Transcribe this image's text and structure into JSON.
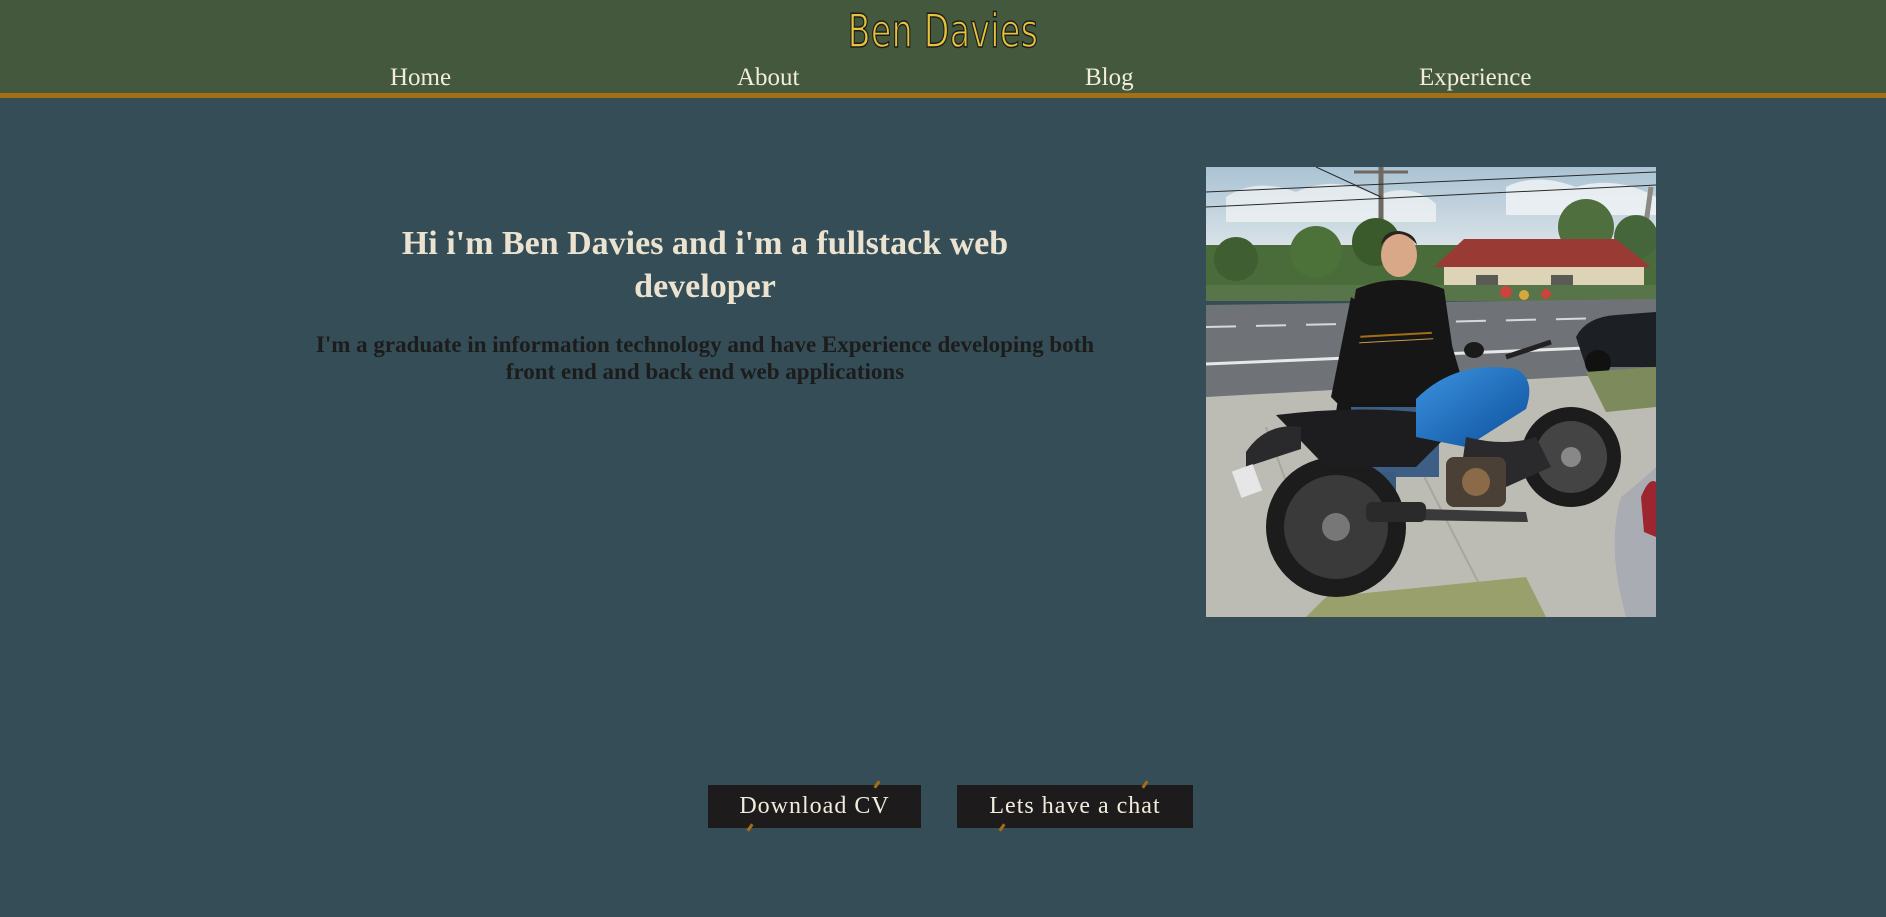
{
  "header": {
    "brand": "Ben Davies",
    "nav": {
      "home": "Home",
      "about": "About",
      "blog": "Blog",
      "experience": "Experience"
    }
  },
  "hero": {
    "title": "Hi i'm Ben Davies and i'm a fullstack web developer",
    "subtitle": "I'm a graduate in information technology and have Experience developing both front end and back end web applications"
  },
  "photo": {
    "alt": "Ben Davies standing next to a blue motorcycle"
  },
  "actions": {
    "download_cv": "Download CV",
    "chat": "Lets have a chat"
  },
  "colors": {
    "page_bg": "#344d56",
    "header_bg": "#43583d",
    "accent_border": "#a46e15",
    "brand_text": "#e6c33a",
    "button_bg": "#1e1b1c"
  },
  "icons": []
}
